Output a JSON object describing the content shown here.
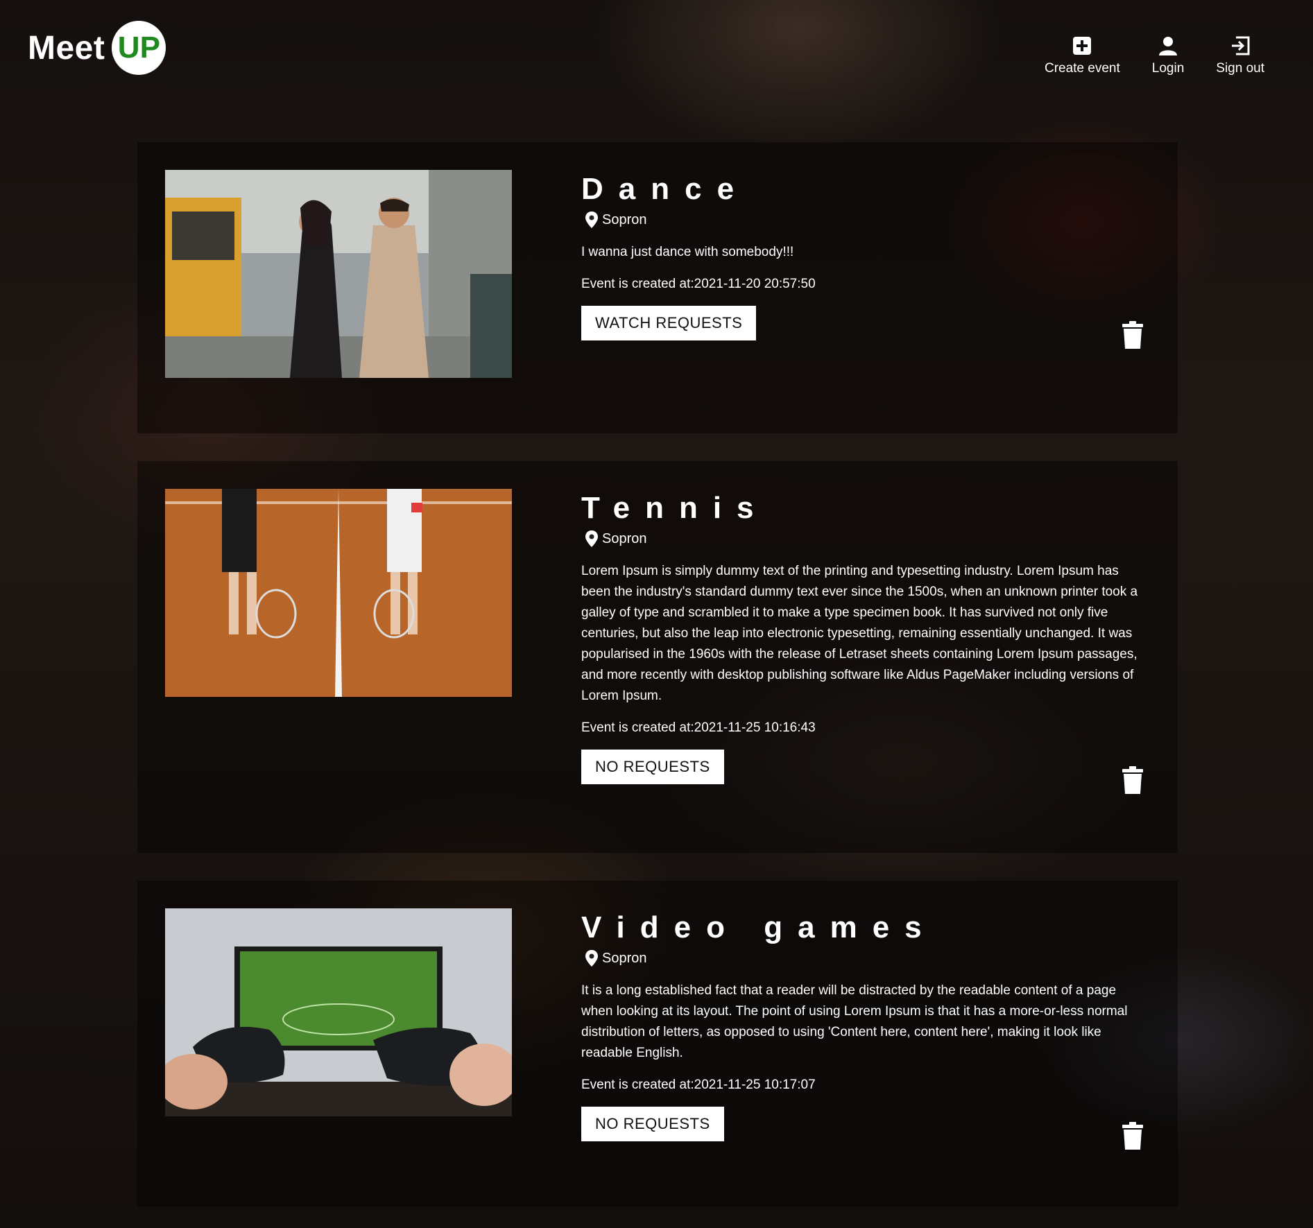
{
  "logo": {
    "meet": "Meet",
    "up": "UP"
  },
  "nav": {
    "create_event": "Create event",
    "login": "Login",
    "sign_out": "Sign out"
  },
  "events": [
    {
      "title": "Dance",
      "location": "Sopron",
      "description": "I wanna just dance with somebody!!!",
      "created": "Event is created at:2021-11-20 20:57:50",
      "button": "WATCH REQUESTS"
    },
    {
      "title": "Tennis",
      "location": "Sopron",
      "description": "Lorem Ipsum is simply dummy text of the printing and typesetting industry. Lorem Ipsum has been the industry's standard dummy text ever since the 1500s, when an unknown printer took a galley of type and scrambled it to make a type specimen book. It has survived not only five centuries, but also the leap into electronic typesetting, remaining essentially unchanged. It was popularised in the 1960s with the release of Letraset sheets containing Lorem Ipsum passages, and more recently with desktop publishing software like Aldus PageMaker including versions of Lorem Ipsum.",
      "created": "Event is created at:2021-11-25 10:16:43",
      "button": "NO REQUESTS"
    },
    {
      "title": "Video games",
      "location": "Sopron",
      "description": "It is a long established fact that a reader will be distracted by the readable content of a page when looking at its layout. The point of using Lorem Ipsum is that it has a more-or-less normal distribution of letters, as opposed to using 'Content here, content here', making it look like readable English.",
      "created": "Event is created at:2021-11-25 10:17:07",
      "button": "NO REQUESTS"
    }
  ],
  "colors": {
    "logo_green": "#1f8a1f",
    "card_overlay": "rgba(0,0,0,0.42)"
  },
  "icons": {
    "create": "plus-square-icon",
    "login": "user-icon",
    "sign_out": "sign-out-icon",
    "location": "map-pin-icon",
    "delete": "trash-icon"
  }
}
